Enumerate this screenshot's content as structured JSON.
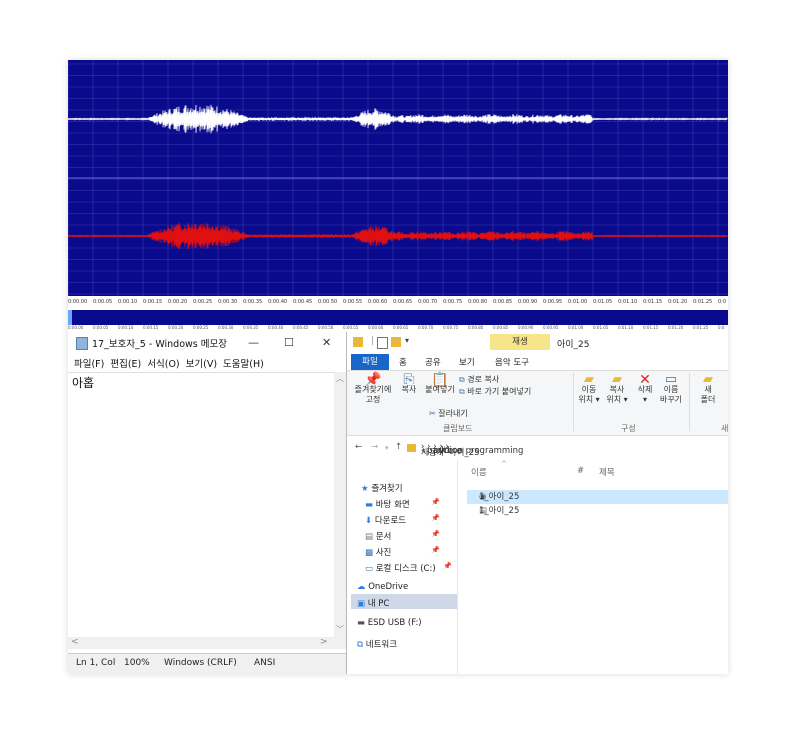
{
  "wave_editor": {
    "timeline": [
      "0:00.00",
      "0:00.05",
      "0:00.10",
      "0:00.15",
      "0:00.20",
      "0:00.25",
      "0:00.30",
      "0:00.35",
      "0:00.40",
      "0:00.45",
      "0:00.50",
      "0:00.55",
      "0:00.60",
      "0:00.65",
      "0:00.70",
      "0:00.75",
      "0:00.80",
      "0:00.85",
      "0:00.90",
      "0:00.95",
      "0:01.00",
      "0:01.05",
      "0:01.10",
      "0:01.15",
      "0:01.20",
      "0:01.25",
      "0:0"
    ],
    "colors": {
      "background": "#0a0a8c",
      "left_channel": "#ffffff",
      "right_channel": "#e01010"
    }
  },
  "notepad": {
    "title": "17_보호자_5 - Windows 메모장",
    "controls": {
      "minimize": "—",
      "maximize": "☐",
      "close": "✕"
    },
    "menu": [
      "파일(F)",
      "편집(E)",
      "서식(O)",
      "보기(V)",
      "도움말(H)"
    ],
    "content": "아홉",
    "status": {
      "position": "Ln 1, Col",
      "zoom": "100%",
      "line_ending": "Windows (CRLF)",
      "encoding": "ANSI"
    }
  },
  "explorer": {
    "context_tab": "재생",
    "window_title": "아이_25",
    "tabs": [
      "파일",
      "홈",
      "공유",
      "보기",
      "음악 도구"
    ],
    "ribbon": {
      "pin": "즐겨찾기에\n고정",
      "copy": "복사",
      "paste": "붙여넣기",
      "copy_path": "경로 복사",
      "paste_shortcut": "바로 가기 붙여넣기",
      "cut": "잘라내기",
      "group_clipboard": "클립보드",
      "move_to": "이동\n위치 ▾",
      "copy_to": "복사\n위치 ▾",
      "delete": "삭제\n▾",
      "rename": "이름\n바꾸기",
      "new_folder": "새\n폴더",
      "group_organize": "구성",
      "group_new": "새"
    },
    "breadcrumb": [
      "«",
      "사용자",
      "park",
      "python programming",
      "voice",
      "1",
      "아이_25"
    ],
    "nav_items": [
      "즐겨찾기",
      "바탕 화면",
      "다운로드",
      "문서",
      "사진",
      "로컬 디스크 (C:)",
      "OneDrive",
      "내 PC",
      "ESD USB (F:)",
      "네트워크"
    ],
    "columns": [
      "이름",
      "#",
      "제목"
    ],
    "files": [
      "1_아이_25",
      "1_아이_25"
    ]
  }
}
